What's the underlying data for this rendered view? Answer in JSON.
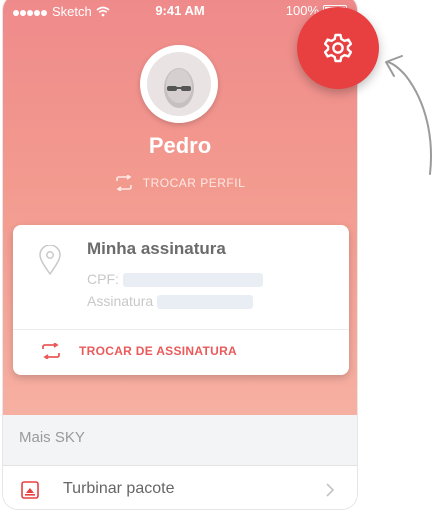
{
  "status": {
    "carrier": "Sketch",
    "time": "9:41 AM",
    "battery": "100%"
  },
  "profile": {
    "name": "Pedro",
    "switch_label": "TROCAR PERFIL"
  },
  "subscription": {
    "title": "Minha assinatura",
    "cpf_label": "CPF:",
    "subscription_label": "Assinatura",
    "action_label": "TROCAR DE ASSINATURA"
  },
  "more": {
    "section_title": "Mais SKY",
    "items": [
      {
        "label": "Turbinar pacote",
        "icon": "package-icon"
      }
    ]
  },
  "colors": {
    "accent": "#e84040",
    "hero_top": "#ef8a8b",
    "hero_bottom": "#f6b0a2"
  }
}
